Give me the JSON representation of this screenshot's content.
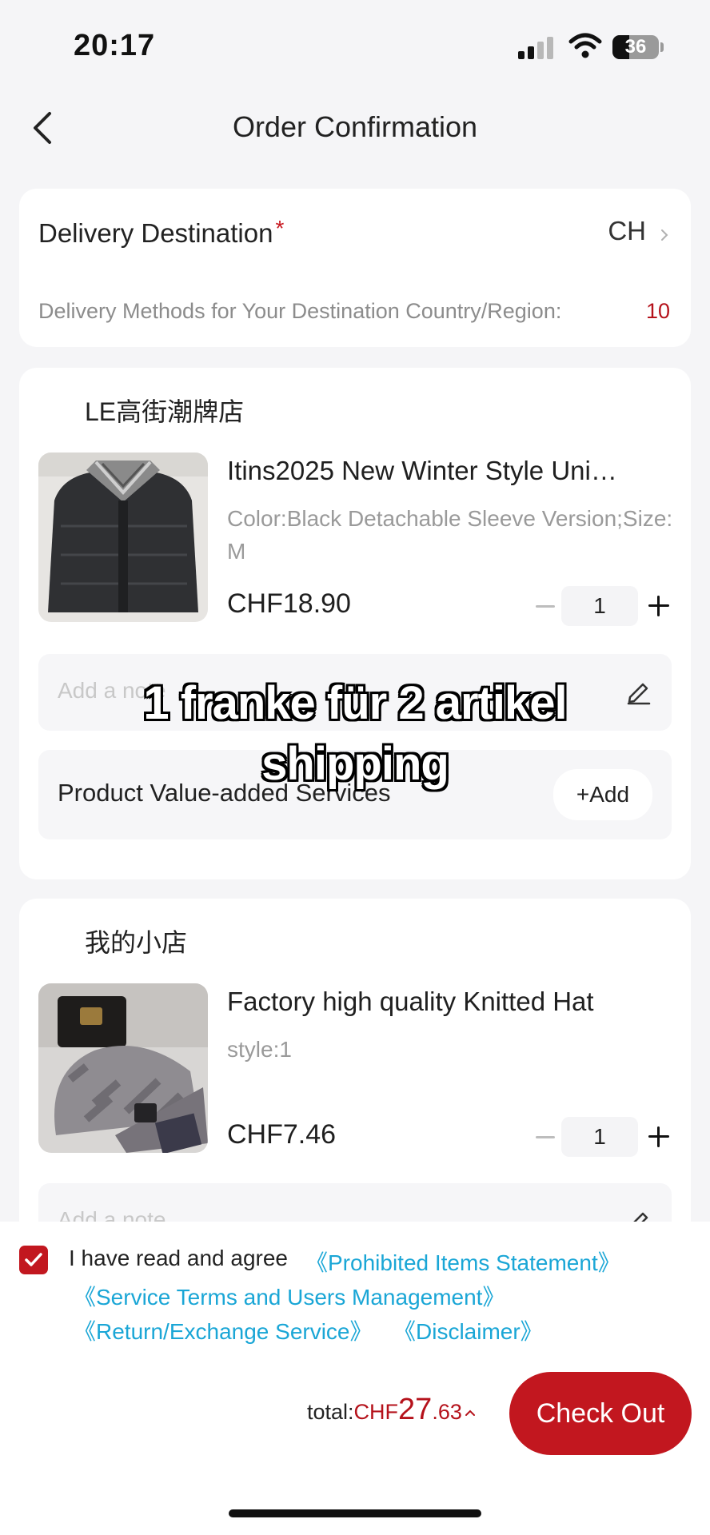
{
  "status_bar": {
    "time": "20:17",
    "battery": "36"
  },
  "header": {
    "title": "Order Confirmation"
  },
  "delivery": {
    "label": "Delivery Destination",
    "required_mark": "*",
    "destination": "CH",
    "methods_label": "Delivery Methods for Your Destination Country/Region:",
    "methods_count": "10"
  },
  "stores": [
    {
      "name": "LE高街潮牌店",
      "product": {
        "title": "Itins2025 New Winter Style Uni…",
        "variant": "Color:Black Detachable Sleeve Version;Size:M",
        "price": "CHF18.90",
        "quantity": "1"
      },
      "note_placeholder": "Add a note",
      "services_label": "Product Value-added Services",
      "add_label": "+Add"
    },
    {
      "name": "我的小店",
      "product": {
        "title": "Factory high quality Knitted Hat",
        "variant": "style:1",
        "price": "CHF7.46",
        "quantity": "1"
      },
      "note_placeholder": "Add a note"
    }
  ],
  "overlay_caption": {
    "line1": "1 franke für 2 artikel",
    "line2": "shipping"
  },
  "agreement": {
    "checked": true,
    "text": "I have read and agree",
    "links": [
      "《Prohibited Items Statement》",
      "《Service Terms and Users Management》",
      "《Return/Exchange Service》",
      "《Disclaimer》"
    ]
  },
  "footer": {
    "total_label": "total:",
    "currency": "CHF",
    "total_integer": "27",
    "total_decimal": ".63",
    "checkout_label": "Check Out"
  },
  "colors": {
    "accent": "#c2171f",
    "price_red": "#b5121b",
    "link": "#1aa6d6",
    "background": "#f5f5f7"
  },
  "icons": [
    "back-arrow",
    "chevron-right",
    "edit-pencil",
    "minus",
    "plus",
    "checkmark",
    "caret-up",
    "signal",
    "wifi",
    "battery"
  ]
}
